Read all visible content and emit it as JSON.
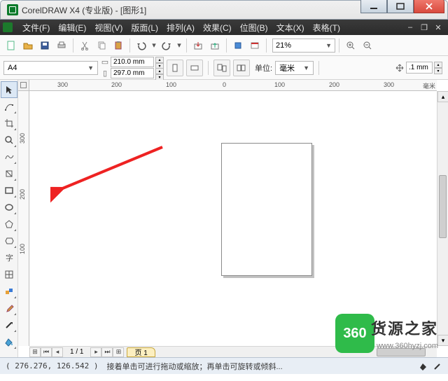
{
  "title": "CorelDRAW X4 (专业版) - [图形1]",
  "menu": {
    "file": "文件(F)",
    "edit": "编辑(E)",
    "view": "视图(V)",
    "layout": "版面(L)",
    "arrange": "排列(A)",
    "effects": "效果(C)",
    "bitmap": "位图(B)",
    "text": "文本(X)",
    "table": "表格(T)"
  },
  "toolbar": {
    "zoom": "21%"
  },
  "prop": {
    "page_size": "A4",
    "width": "210.0 mm",
    "height": "297.0 mm",
    "units_label": "单位:",
    "units_value": "毫米",
    "nudge": ".1 mm"
  },
  "ruler": {
    "unit": "毫米",
    "hticks": [
      "300",
      "200",
      "100",
      "0",
      "100",
      "200",
      "300"
    ],
    "vticks": [
      "300",
      "200",
      "100"
    ]
  },
  "pages": {
    "counter": "1 / 1",
    "tab": "页 1"
  },
  "status": {
    "coords": "( 276.276, 126.542 )",
    "hint": "接着单击可进行拖动或缩放；再单击可旋转或倾斜..."
  },
  "branding": {
    "badge": "360",
    "name": "货源之家",
    "url": "www.360hyzj.com"
  }
}
